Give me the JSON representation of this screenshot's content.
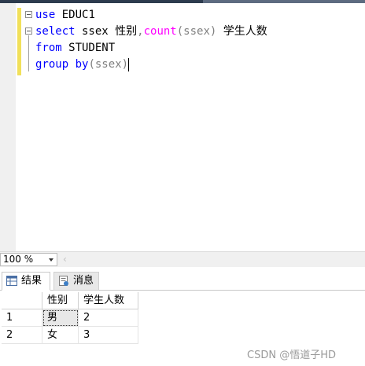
{
  "editor": {
    "lines": [
      {
        "kw1": "use",
        "rest": " EDUC1"
      },
      {
        "kw1": "select",
        "mid": " ssex 性别",
        "comma": ",",
        "fn": "count",
        "paren": "(ssex)",
        "alias": " 学生人数"
      },
      {
        "kw1": "from",
        "rest": " STUDENT"
      },
      {
        "kw1": "group by",
        "paren": "(ssex)"
      }
    ]
  },
  "status": {
    "zoom": "100 %"
  },
  "tabs": [
    {
      "label": "结果",
      "icon": "grid-icon"
    },
    {
      "label": "消息",
      "icon": "message-icon"
    }
  ],
  "results": {
    "columns": [
      "性别",
      "学生人数"
    ],
    "rows": [
      {
        "num": "1",
        "cells": [
          "男",
          "2"
        ]
      },
      {
        "num": "2",
        "cells": [
          "女",
          "3"
        ]
      }
    ]
  },
  "watermark": "CSDN @悟道子HD",
  "colors": {
    "keyword": "#0000ff",
    "function": "#ff00ff",
    "changebar": "#f1e05a"
  }
}
